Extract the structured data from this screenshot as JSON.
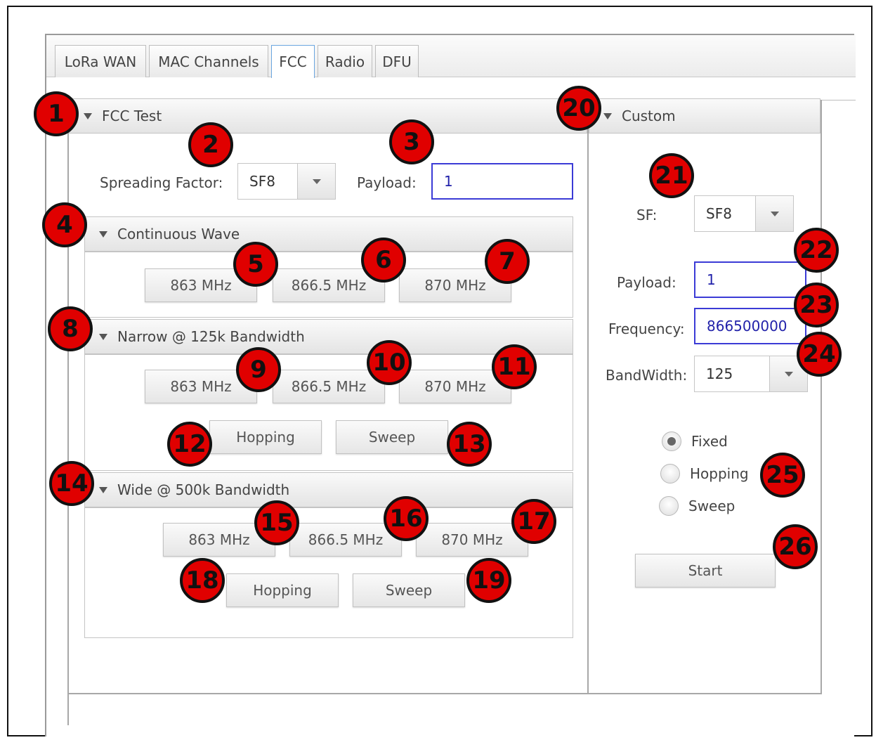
{
  "tabs": [
    "LoRa WAN",
    "MAC Channels",
    "FCC",
    "Radio",
    "DFU"
  ],
  "fcc_test": {
    "header": "FCC Test",
    "spreading_factor_label": "Spreading Factor:",
    "spreading_factor_value": "SF8",
    "payload_label": "Payload:",
    "payload_value": "1",
    "continuous_wave": {
      "header": "Continuous Wave",
      "buttons": [
        "863 MHz",
        "866.5 MHz",
        "870 MHz"
      ]
    },
    "narrow": {
      "header": "Narrow @ 125k Bandwidth",
      "buttons": [
        "863 MHz",
        "866.5 MHz",
        "870 MHz"
      ],
      "hopping": "Hopping",
      "sweep": "Sweep"
    },
    "wide": {
      "header": "Wide @ 500k Bandwidth",
      "buttons": [
        "863 MHz",
        "866.5 MHz",
        "870 MHz"
      ],
      "hopping": "Hopping",
      "sweep": "Sweep"
    }
  },
  "custom": {
    "header": "Custom",
    "sf_label": "SF:",
    "sf_value": "SF8",
    "payload_label": "Payload:",
    "payload_value": "1",
    "frequency_label": "Frequency:",
    "frequency_value": "866500000",
    "bandwidth_label": "BandWidth:",
    "bandwidth_value": "125",
    "modes": [
      "Fixed",
      "Hopping",
      "Sweep"
    ],
    "selected_mode": "Fixed",
    "start": "Start"
  },
  "badges": [
    "1",
    "2",
    "3",
    "4",
    "5",
    "6",
    "7",
    "8",
    "9",
    "10",
    "11",
    "12",
    "13",
    "14",
    "15",
    "16",
    "17",
    "18",
    "19",
    "20",
    "21",
    "22",
    "23",
    "24",
    "25",
    "26"
  ],
  "colors": {
    "badge": "#e00000",
    "input_border": "#3b3bd6",
    "active_tab_border": "#6aa6e0"
  }
}
